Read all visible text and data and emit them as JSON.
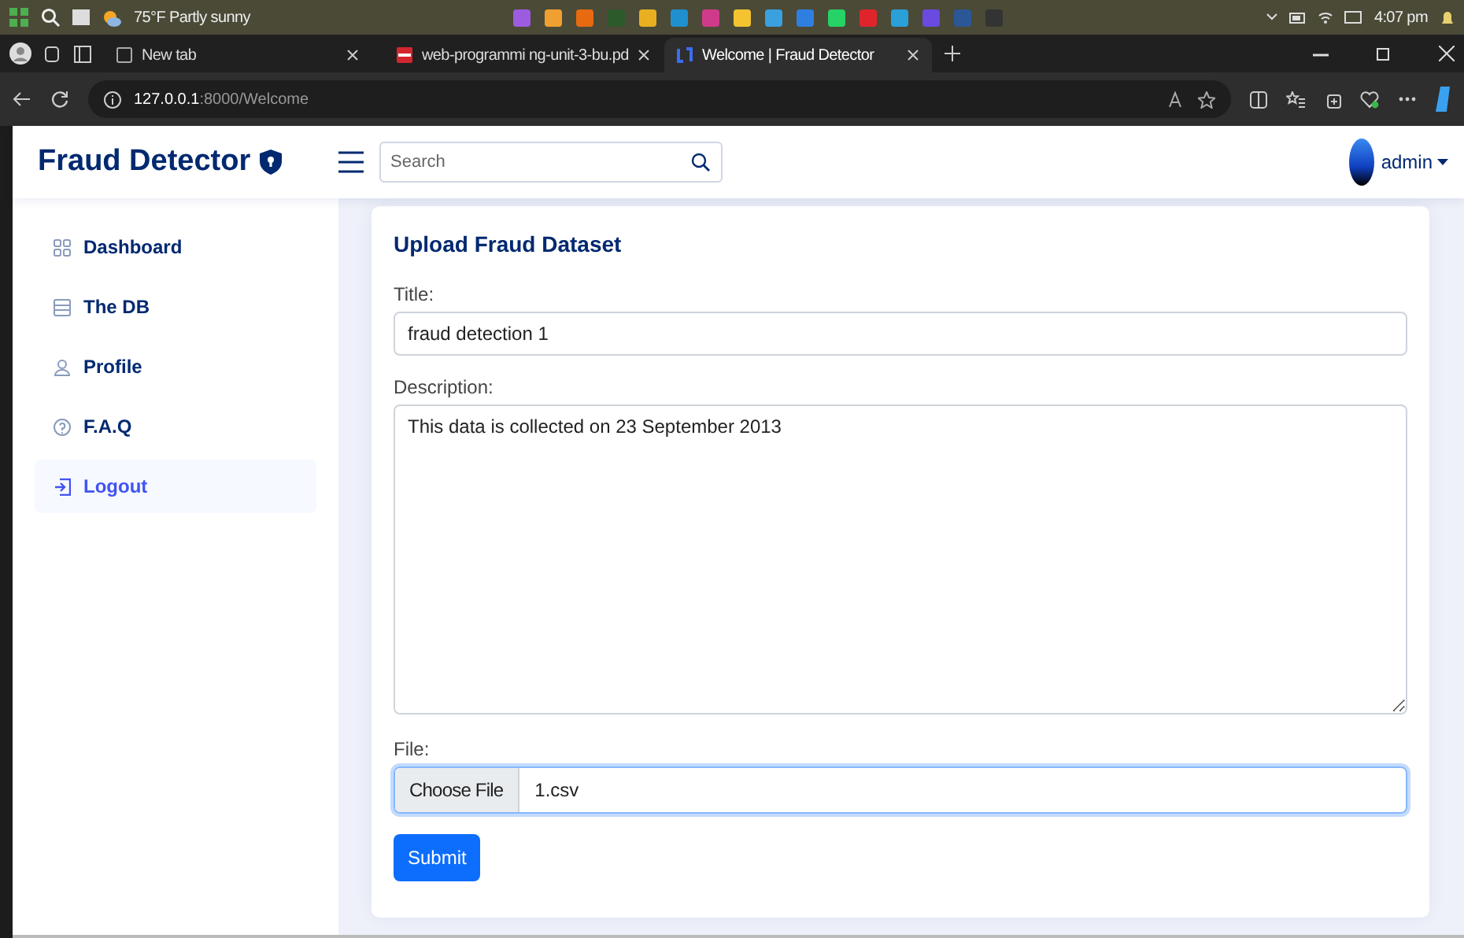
{
  "taskbar": {
    "weather": "75°F Partly sunny",
    "clock": "4:07 pm"
  },
  "browser": {
    "tabs": [
      {
        "title": "New tab",
        "kind": "newtab",
        "selected": false
      },
      {
        "title": "web-programmi ng-unit-3-bu.pd",
        "kind": "pdf",
        "selected": false
      },
      {
        "title": "Welcome | Fraud Detector",
        "kind": "site",
        "selected": true
      }
    ],
    "address": {
      "host": "127.0.0.1",
      "path": ":8000/Welcome"
    }
  },
  "header": {
    "brand": "Fraud Detector",
    "search": {
      "placeholder": "Search"
    },
    "user": "admin"
  },
  "sidebar": {
    "items": [
      {
        "label": "Dashboard",
        "kind": "grid",
        "selected": false
      },
      {
        "label": "The DB",
        "kind": "db",
        "selected": false
      },
      {
        "label": "Profile",
        "kind": "person",
        "selected": false
      },
      {
        "label": "F.A.Q",
        "kind": "help",
        "selected": false
      },
      {
        "label": "Logout",
        "kind": "logout",
        "selected": true
      }
    ]
  },
  "form": {
    "heading": "Upload Fraud Dataset",
    "title": {
      "label": "Title:",
      "value": "fraud detection 1"
    },
    "description": {
      "label": "Description:",
      "value": "This data is collected on 23 September 2013"
    },
    "file": {
      "label": "File:",
      "button": "Choose File",
      "filename": "1.csv",
      "focused": true
    },
    "submit": "Submit"
  }
}
